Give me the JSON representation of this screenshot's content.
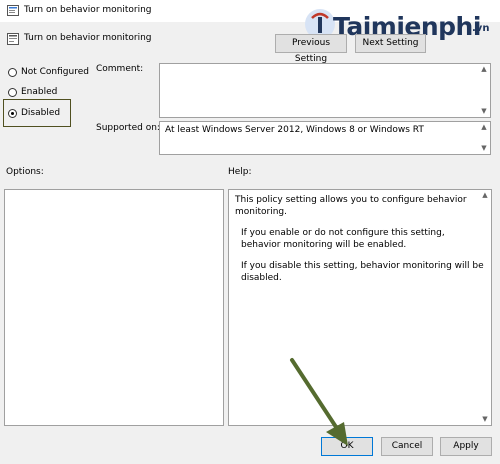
{
  "window": {
    "title": "Turn on behavior monitoring"
  },
  "watermark": {
    "brand": "Taimienphi",
    "suffix": ".vn"
  },
  "header": {
    "policy_name": "Turn on behavior monitoring",
    "previous_label": "Previous Setting",
    "next_label": "Next Setting"
  },
  "state": {
    "options": [
      {
        "label": "Not Configured",
        "selected": false
      },
      {
        "label": "Enabled",
        "selected": false
      },
      {
        "label": "Disabled",
        "selected": true
      }
    ]
  },
  "comment": {
    "label": "Comment:",
    "value": ""
  },
  "supported": {
    "label": "Supported on:",
    "value": "At least Windows Server 2012, Windows 8 or Windows RT"
  },
  "panes": {
    "options_label": "Options:",
    "help_label": "Help:",
    "help_paragraphs": [
      "This policy setting allows you to configure behavior monitoring.",
      "If you enable or do not configure this setting, behavior monitoring will be enabled.",
      "If you disable this setting, behavior monitoring will be disabled."
    ]
  },
  "buttons": {
    "ok": "OK",
    "cancel": "Cancel",
    "apply": "Apply"
  },
  "colors": {
    "highlight_box": "#505020",
    "arrow": "#556b2f",
    "ok_border": "#0078d7"
  }
}
